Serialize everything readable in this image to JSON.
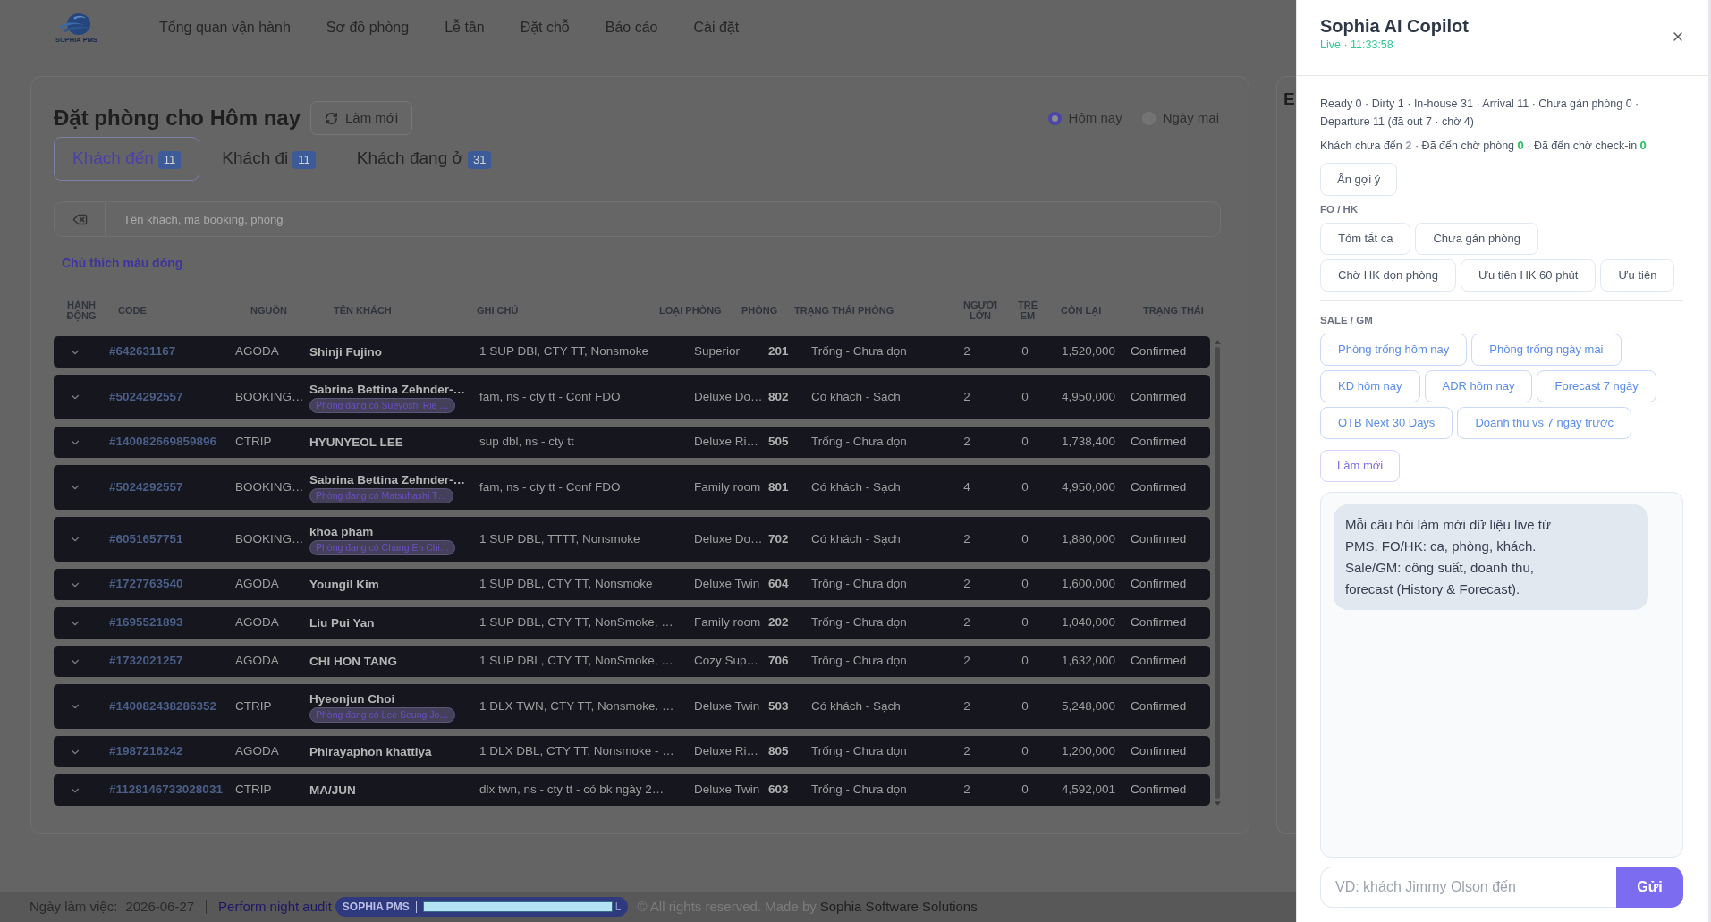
{
  "nav": {
    "logo": {
      "name": "SOPHIA",
      "suffix": "PMS"
    },
    "items": [
      "Tổng quan vận hành",
      "Sơ đồ phòng",
      "Lễ tân",
      "Đặt chỗ",
      "Báo cáo",
      "Cài đặt"
    ]
  },
  "bookings": {
    "title": "Đặt phòng cho Hôm nay",
    "refresh_button": "Làm mới",
    "date_options": [
      {
        "label": "Hôm nay",
        "selected": true
      },
      {
        "label": "Ngày mai",
        "selected": false
      }
    ],
    "tabs": [
      {
        "label": "Khách đến",
        "count": "11",
        "selected": true
      },
      {
        "label": "Khách đi",
        "count": "11",
        "selected": false
      },
      {
        "label": "Khách đang ở",
        "count": "31",
        "selected": false
      }
    ],
    "search": {
      "placeholder": "Tên khách, mã booking, phòng"
    },
    "legend_link": "Chú thích màu dòng",
    "table": {
      "columns": [
        "HÀNH ĐỘNG",
        "CODE",
        "NGUỒN",
        "TÊN KHÁCH",
        "GHI CHÚ",
        "LOẠI PHÒNG",
        "PHÒNG",
        "TRẠNG THÁI PHÒNG",
        "NGƯỜI LỚN",
        "TRẺ EM",
        "CÒN LẠI",
        "TRẠNG THÁI"
      ],
      "rows": [
        {
          "code": "#642631167",
          "source": "AGODA",
          "guest": "Shinji Fujino",
          "note": "1 SUP DBl, CTY TT, Nonsmoke",
          "room_type": "Superior",
          "room": "201",
          "room_status": "Trống - Chưa dọn",
          "adults": "2",
          "children": "0",
          "balance": "1,520,000",
          "status": "Confirmed"
        },
        {
          "code": "#5024292557",
          "source": "BOOKING…",
          "guest": "Sabrina Bettina Zehnder-…",
          "tag": "Phòng đang có Sueyoshi Rie …",
          "note": "fam, ns - cty tt - Conf FDO",
          "room_type": "Deluxe Do…",
          "room": "802",
          "room_status": "Có khách - Sạch",
          "adults": "2",
          "children": "0",
          "balance": "4,950,000",
          "status": "Confirmed"
        },
        {
          "code": "#140082669859896",
          "source": "CTRIP",
          "guest": "HYUNYEOL LEE",
          "note": "sup dbl, ns - cty tt",
          "room_type": "Deluxe Ri…",
          "room": "505",
          "room_status": "Trống - Chưa dọn",
          "adults": "2",
          "children": "0",
          "balance": "1,738,400",
          "status": "Confirmed"
        },
        {
          "code": "#5024292557",
          "source": "BOOKING…",
          "guest": "Sabrina Bettina Zehnder-…",
          "tag": "Phòng đang có Matsuhashi T…",
          "note": "fam, ns - cty tt - Conf FDO",
          "room_type": "Family room",
          "room": "801",
          "room_status": "Có khách - Sạch",
          "adults": "4",
          "children": "0",
          "balance": "4,950,000",
          "status": "Confirmed"
        },
        {
          "code": "#6051657751",
          "source": "BOOKING…",
          "guest": "khoa phạm",
          "tag": "Phòng đang có Chang En Chi…",
          "note": "1 SUP DBL, TTTT, Nonsmoke",
          "room_type": "Deluxe Do…",
          "room": "702",
          "room_status": "Có khách - Sạch",
          "adults": "2",
          "children": "0",
          "balance": "1,880,000",
          "status": "Confirmed"
        },
        {
          "code": "#1727763540",
          "source": "AGODA",
          "guest": "Youngil Kim",
          "note": "1 SUP DBL, CTY TT, Nonsmoke",
          "room_type": "Deluxe Twin",
          "room": "604",
          "room_status": "Trống - Chưa dọn",
          "adults": "2",
          "children": "0",
          "balance": "1,600,000",
          "status": "Confirmed"
        },
        {
          "code": "#1695521893",
          "source": "AGODA",
          "guest": "Liu Pui Yan",
          "note": "1 SUP DBL, CTY TT, NonSmoke, …",
          "room_type": "Family room",
          "room": "202",
          "room_status": "Trống - Chưa dọn",
          "adults": "2",
          "children": "0",
          "balance": "1,040,000",
          "status": "Confirmed"
        },
        {
          "code": "#1732021257",
          "source": "AGODA",
          "guest": "CHI HON TANG",
          "note": "1 SUP DBL, CTY TT, NonSmoke, …",
          "room_type": "Cozy Sup…",
          "room": "706",
          "room_status": "Trống - Chưa dọn",
          "adults": "2",
          "children": "0",
          "balance": "1,632,000",
          "status": "Confirmed"
        },
        {
          "code": "#140082438286352",
          "source": "CTRIP",
          "guest": "Hyeonjun Choi",
          "tag": "Phòng đang có Lee Seung Jo…",
          "note": "1 DLX TWN, CTY TT, Nonsmoke. …",
          "room_type": "Deluxe Twin",
          "room": "503",
          "room_status": "Có khách - Sạch",
          "adults": "2",
          "children": "0",
          "balance": "5,248,000",
          "status": "Confirmed"
        },
        {
          "code": "#1987216242",
          "source": "AGODA",
          "guest": "Phirayaphon khattiya",
          "note": "1 DLX DBL, CTY TT, Nonsmoke - …",
          "room_type": "Deluxe Ri…",
          "room": "805",
          "room_status": "Trống - Chưa dọn",
          "adults": "2",
          "children": "0",
          "balance": "1,200,000",
          "status": "Confirmed"
        },
        {
          "code": "#1128146733028031",
          "source": "CTRIP",
          "guest": "MA/JUN",
          "note": "dlx twn, ns - cty tt - có bk ngày 2…",
          "room_type": "Deluxe Twin",
          "room": "603",
          "room_status": "Trống - Chưa dọn",
          "adults": "2",
          "children": "0",
          "balance": "4,592,001",
          "status": "Confirmed"
        }
      ]
    }
  },
  "side_card": {
    "title": "E"
  },
  "footer": {
    "work_date_label": "Ngày làm việc:",
    "work_date": "2026-06-27",
    "night_audit_link": "Perform night audit",
    "badge": "SOPHIA PMS",
    "badge_tail": "L",
    "copyright": "© All rights reserved. Made by",
    "company": "Sophia Software Solutions"
  },
  "copilot": {
    "title": "Sophia AI Copilot",
    "status": "Live · 11:33:58",
    "summary": "Ready 0 · Dirty 1 · In-house 31 · Arrival 11 · Chưa gán phòng 0 · Departure 11 (đã out 7 · chờ 4)",
    "guest_stats": [
      {
        "label": "Khách chưa đến",
        "value": "2",
        "color": "#9ca3af"
      },
      {
        "label": "· Đã đến chờ phòng",
        "value": "0",
        "color": "#22c55e"
      },
      {
        "label": "· Đã đến chờ check-in",
        "value": "0",
        "color": "#22c55e"
      }
    ],
    "toggle_button": "Ẩn gợi ý",
    "groups": [
      {
        "title": "FO / HK",
        "kind": "fo",
        "rows": [
          [
            "Tóm tắt ca",
            "Chưa gán phòng"
          ],
          [
            "Chờ HK dọn phòng",
            "Ưu tiên HK 60 phút",
            "Ưu tiên"
          ]
        ]
      },
      {
        "title": "SALE / GM",
        "kind": "sale",
        "rows": [
          [
            "Phòng trống hôm nay",
            "Phòng trống ngày mai"
          ],
          [
            "KD hôm nay",
            "ADR hôm nay",
            "Forecast 7 ngày"
          ],
          [
            "OTB Next 30 Days",
            "Doanh thu vs 7 ngày trước"
          ]
        ]
      }
    ],
    "refresh_button": "Làm mới",
    "messages": [
      {
        "kind": "assistant",
        "text": "Mỗi câu hỏi làm mới dữ liệu live từ PMS. FO/HK: ca, phòng, khách. Sale/GM: công suất, doanh thu, forecast (History & Forecast)."
      }
    ],
    "input": {
      "placeholder": "VD: khách Jimmy Olson đến"
    },
    "send_button": "Gửi"
  }
}
